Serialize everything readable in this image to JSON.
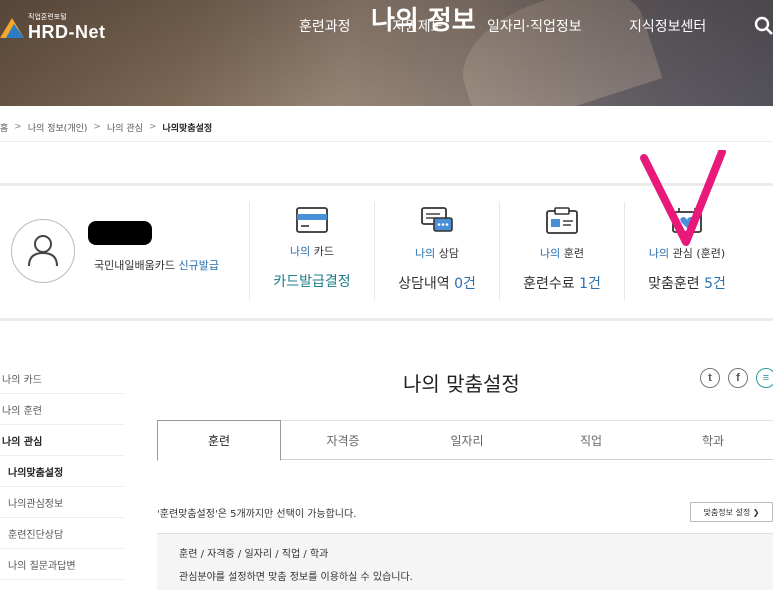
{
  "header": {
    "logo_sub": "직업훈련포털",
    "logo_name": "HRD-Net",
    "nav": [
      "훈련과정",
      "지원제도",
      "일자리·직업정보",
      "지식정보센터"
    ],
    "title": "나의 정보",
    "search_icon": "search-icon"
  },
  "breadcrumb": [
    "홈",
    "나의 정보(개인)",
    "나의 관심",
    "나의맞춤설정"
  ],
  "profile": {
    "card_status_text": "국민내일배움카드",
    "card_status_link": "신규발급"
  },
  "stats": [
    {
      "icon": "card-icon",
      "label_hl": "나의",
      "label": " 카드",
      "value": "카드발급결정",
      "num": ""
    },
    {
      "icon": "chat-icon",
      "label_hl": "나의",
      "label": " 상담",
      "value": "상담내역 ",
      "num": "0건"
    },
    {
      "icon": "training-icon",
      "label_hl": "나의",
      "label": " 훈련",
      "value": "훈련수료 ",
      "num": "1건"
    },
    {
      "icon": "heart-box-icon",
      "label_hl": "나의",
      "label": " 관심 (훈련)",
      "value": "맞춤훈련 ",
      "num": "5건"
    }
  ],
  "sidebar": [
    "나의 카드",
    "나의 훈련",
    "나의 관심",
    "나의맞춤설정",
    "나의관심정보",
    "훈련진단상담",
    "나의 질문과답변"
  ],
  "main": {
    "title": "나의 맞춤설정",
    "share": [
      "twitter-icon",
      "facebook-icon",
      "share-icon"
    ],
    "tabs": [
      "훈련",
      "자격증",
      "일자리",
      "직업",
      "학과"
    ],
    "notice": "'훈련맞춤설정'은 5개까지만 선택이 가능합니다.",
    "setting_button": "맞춤정보 설정 ❯",
    "info_line1": "훈련 / 자격증 / 일자리 / 직업 / 학과",
    "info_line2": "관심분야를 설정하면 맞춤 정보를 이용하실 수 있습니다."
  },
  "colors": {
    "accent": "#2a6fb0",
    "teal": "#1e7d8a",
    "annotation": "#e8197a"
  }
}
